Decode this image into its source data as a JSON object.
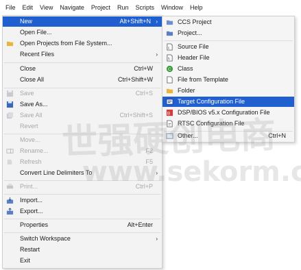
{
  "menubar": [
    "File",
    "Edit",
    "View",
    "Navigate",
    "Project",
    "Run",
    "Scripts",
    "Window",
    "Help"
  ],
  "file_menu": {
    "new": {
      "label": "New",
      "shortcut": "Alt+Shift+N"
    },
    "open_file": {
      "label": "Open File..."
    },
    "open_projects": {
      "label": "Open Projects from File System..."
    },
    "recent_files": {
      "label": "Recent Files"
    },
    "close": {
      "label": "Close",
      "shortcut": "Ctrl+W"
    },
    "close_all": {
      "label": "Close All",
      "shortcut": "Ctrl+Shift+W"
    },
    "save": {
      "label": "Save",
      "shortcut": "Ctrl+S"
    },
    "save_as": {
      "label": "Save As..."
    },
    "save_all": {
      "label": "Save All",
      "shortcut": "Ctrl+Shift+S"
    },
    "revert": {
      "label": "Revert"
    },
    "move": {
      "label": "Move..."
    },
    "rename": {
      "label": "Rename...",
      "shortcut": "F2"
    },
    "refresh": {
      "label": "Refresh",
      "shortcut": "F5"
    },
    "convert": {
      "label": "Convert Line Delimiters To"
    },
    "print": {
      "label": "Print...",
      "shortcut": "Ctrl+P"
    },
    "import": {
      "label": "Import..."
    },
    "export": {
      "label": "Export..."
    },
    "properties": {
      "label": "Properties",
      "shortcut": "Alt+Enter"
    },
    "switch_workspace": {
      "label": "Switch Workspace"
    },
    "restart": {
      "label": "Restart"
    },
    "exit": {
      "label": "Exit"
    }
  },
  "new_submenu": {
    "ccs_project": "CCS Project",
    "project": "Project...",
    "source_file": "Source File",
    "header_file": "Header File",
    "class": "Class",
    "file_from_template": "File from Template",
    "folder": "Folder",
    "target_config": "Target Configuration File",
    "dsp_bios": "DSP/BIOS v5.x Configuration File",
    "rtsc": "RTSC Configuration File",
    "other": {
      "label": "Other...",
      "shortcut": "Ctrl+N"
    }
  },
  "watermark": {
    "line1": "世强硬创电商",
    "line2": "www.sekorm.com"
  },
  "colors": {
    "selection": "#1f5fd0",
    "menu_bg": "#f3f3f3",
    "disabled": "#a8a8a8"
  }
}
